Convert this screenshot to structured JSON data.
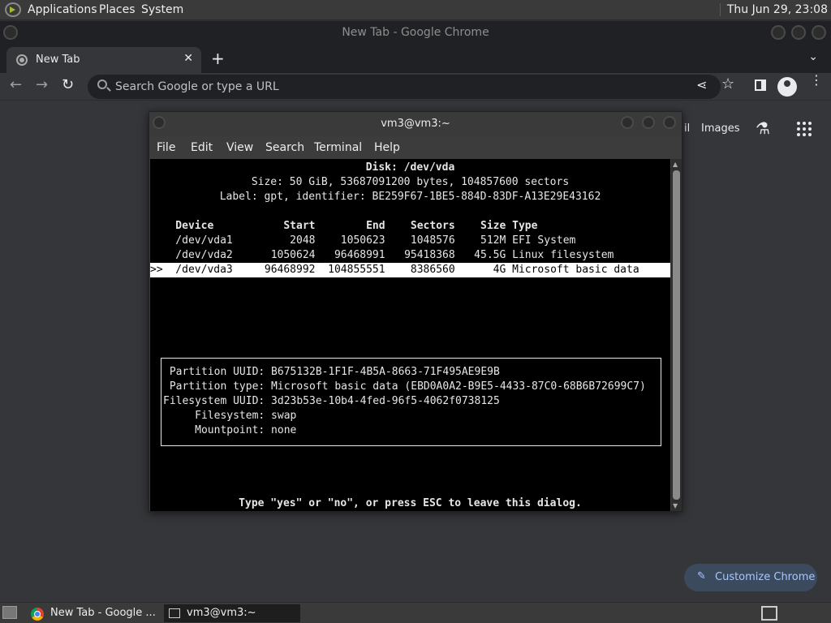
{
  "top_panel": {
    "menus": [
      "Applications",
      "Places",
      "System"
    ],
    "clock": "Thu Jun 29, 23:08"
  },
  "chrome": {
    "window_title": "New Tab - Google Chrome",
    "tab_title": "New Tab",
    "tab_close": "✕",
    "new_tab": "+",
    "tab_menu": "⌄",
    "nav_back": "←",
    "nav_forward": "→",
    "nav_reload": "↻",
    "omnibox_placeholder": "Search Google or type a URL",
    "share_icon": "⋖",
    "star_icon": "☆",
    "kebab": "⋮",
    "ntp_gmail_fragment": "il",
    "ntp_images": "Images",
    "ntp_labs_icon": "⚗",
    "customize_label": "Customize Chrome",
    "customize_icon": "✎"
  },
  "terminal": {
    "title": "vm3@vm3:~",
    "menu": [
      "File",
      "Edit",
      "View",
      "Search",
      "Terminal",
      "Help"
    ],
    "disk_title": "Disk: /dev/vda",
    "size_line": "Size: 50 GiB, 53687091200 bytes, 104857600 sectors",
    "label_line": "Label: gpt, identifier: BE259F67-1BE5-884D-83DF-A13E29E43162",
    "table_header": "    Device           Start        End    Sectors    Size Type",
    "rows": [
      "    /dev/vda1         2048    1050623    1048576    512M EFI System",
      "    /dev/vda2      1050624   96468991   95418368   45.5G Linux filesystem",
      ">>  /dev/vda3     96468992  104855551    8386560      4G Microsoft basic data "
    ],
    "info": [
      " Partition UUID: B675132B-1F1F-4B5A-8663-71F495AE9E9B",
      " Partition type: Microsoft basic data (EBD0A0A2-B9E5-4433-87C0-68B6B72699C7)",
      "Filesystem UUID: 3d23b53e-10b4-4fed-96f5-4062f0738125",
      "     Filesystem: swap",
      "     Mountpoint: none"
    ],
    "prompt": "Type \"yes\" or \"no\", or press ESC to leave this dialog."
  },
  "taskbar": {
    "tasks": [
      "New Tab - Google ...",
      "vm3@vm3:~"
    ]
  }
}
